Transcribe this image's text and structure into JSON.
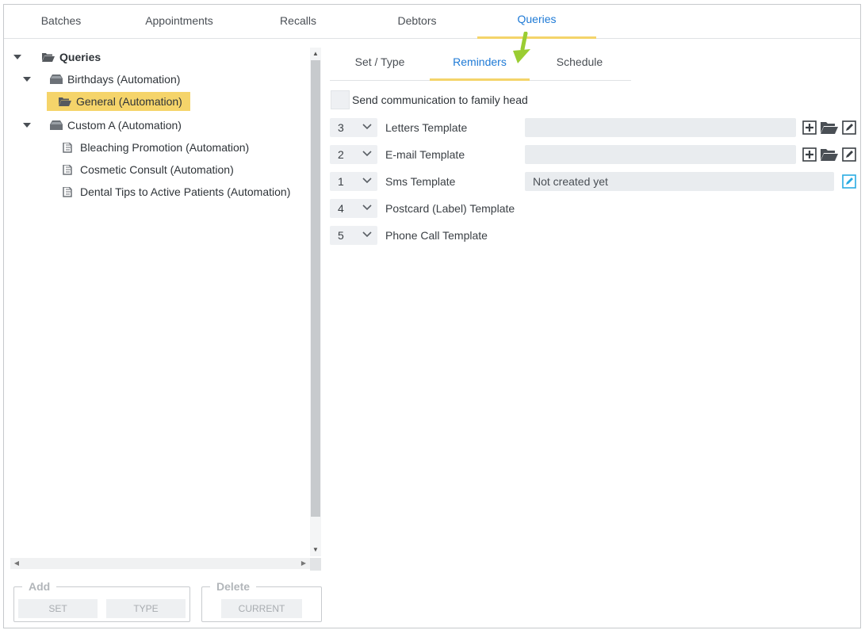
{
  "top_tabs": [
    {
      "label": "Batches"
    },
    {
      "label": "Appointments"
    },
    {
      "label": "Recalls"
    },
    {
      "label": "Debtors"
    },
    {
      "label": "Queries",
      "active": true
    }
  ],
  "tree": {
    "root": {
      "label": "Queries"
    },
    "groups": [
      {
        "label": "Birthdays (Automation)",
        "children": [
          {
            "label": "General (Automation)",
            "selected": true
          }
        ]
      },
      {
        "label": "Custom A (Automation)",
        "children": [
          {
            "label": "Bleaching Promotion (Automation)"
          },
          {
            "label": "Cosmetic Consult (Automation)"
          },
          {
            "label": "Dental Tips to Active Patients (Automation)"
          }
        ]
      }
    ]
  },
  "add_group": {
    "legend": "Add",
    "set_label": "SET",
    "type_label": "TYPE"
  },
  "delete_group": {
    "legend": "Delete",
    "current_label": "CURRENT"
  },
  "sub_tabs": [
    {
      "label": "Set / Type"
    },
    {
      "label": "Reminders",
      "active": true
    },
    {
      "label": "Schedule"
    }
  ],
  "family_head": {
    "label": "Send communication to family head",
    "checked": false
  },
  "templates": [
    {
      "order": "3",
      "label": "Letters Template",
      "value": "",
      "tools": [
        "add",
        "open",
        "edit"
      ]
    },
    {
      "order": "2",
      "label": "E-mail Template",
      "value": "",
      "tools": [
        "add",
        "open",
        "edit"
      ]
    },
    {
      "order": "1",
      "label": "Sms Template",
      "value": "Not created yet",
      "tools": [
        "edit"
      ]
    },
    {
      "order": "4",
      "label": "Postcard (Label) Template"
    },
    {
      "order": "5",
      "label": "Phone Call Template"
    }
  ],
  "colors": {
    "accent": "#1e7ad6",
    "highlight": "#f5d46a",
    "pointer": "#9acd32",
    "edit_icon": "#29abe2"
  }
}
